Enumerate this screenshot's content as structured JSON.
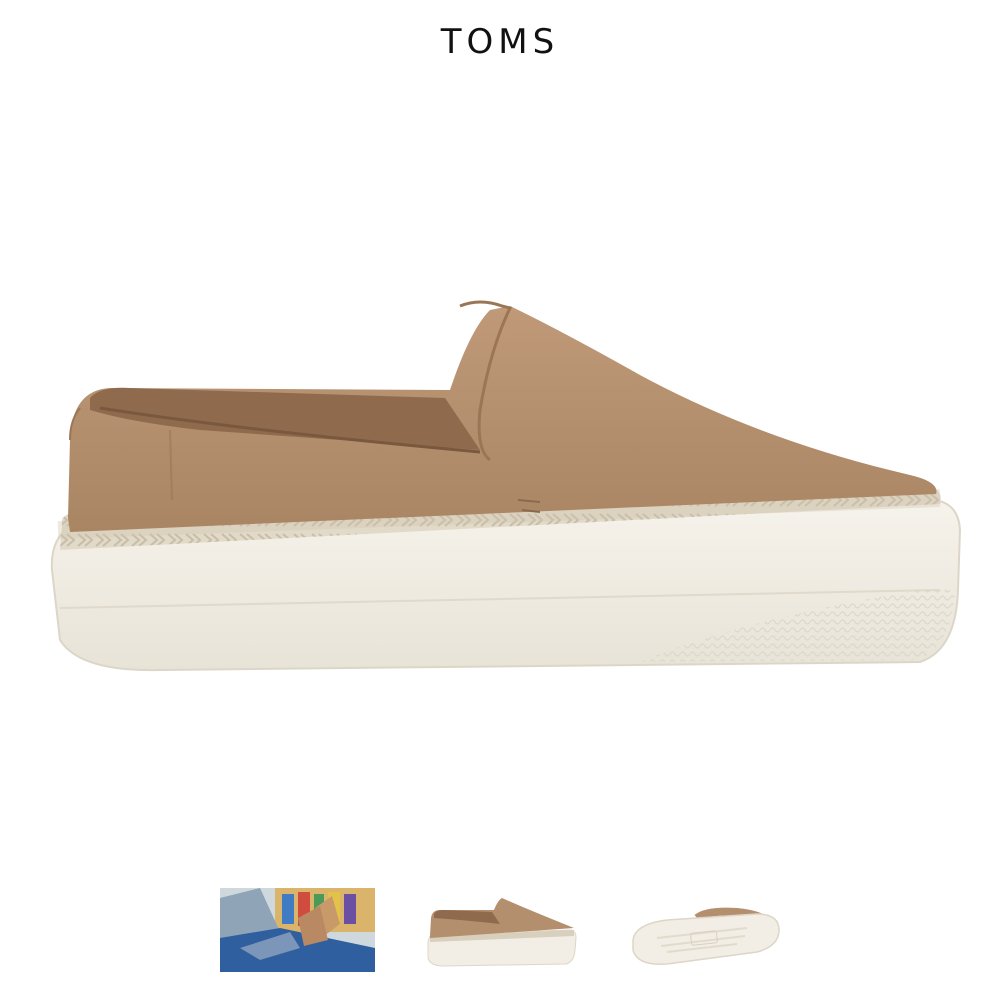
{
  "header": {
    "brand": "TOMS"
  },
  "product": {
    "colors": {
      "suede": "#b48f6e",
      "suede_dark": "#9b7656",
      "lining": "#8f6a4d",
      "sole": "#f1ede4",
      "jute": "#d9d0be"
    }
  },
  "thumbnails": [
    {
      "icon": "lifestyle-car-thumbnail"
    },
    {
      "icon": "side-view-thumbnail"
    },
    {
      "icon": "sole-view-thumbnail"
    }
  ]
}
